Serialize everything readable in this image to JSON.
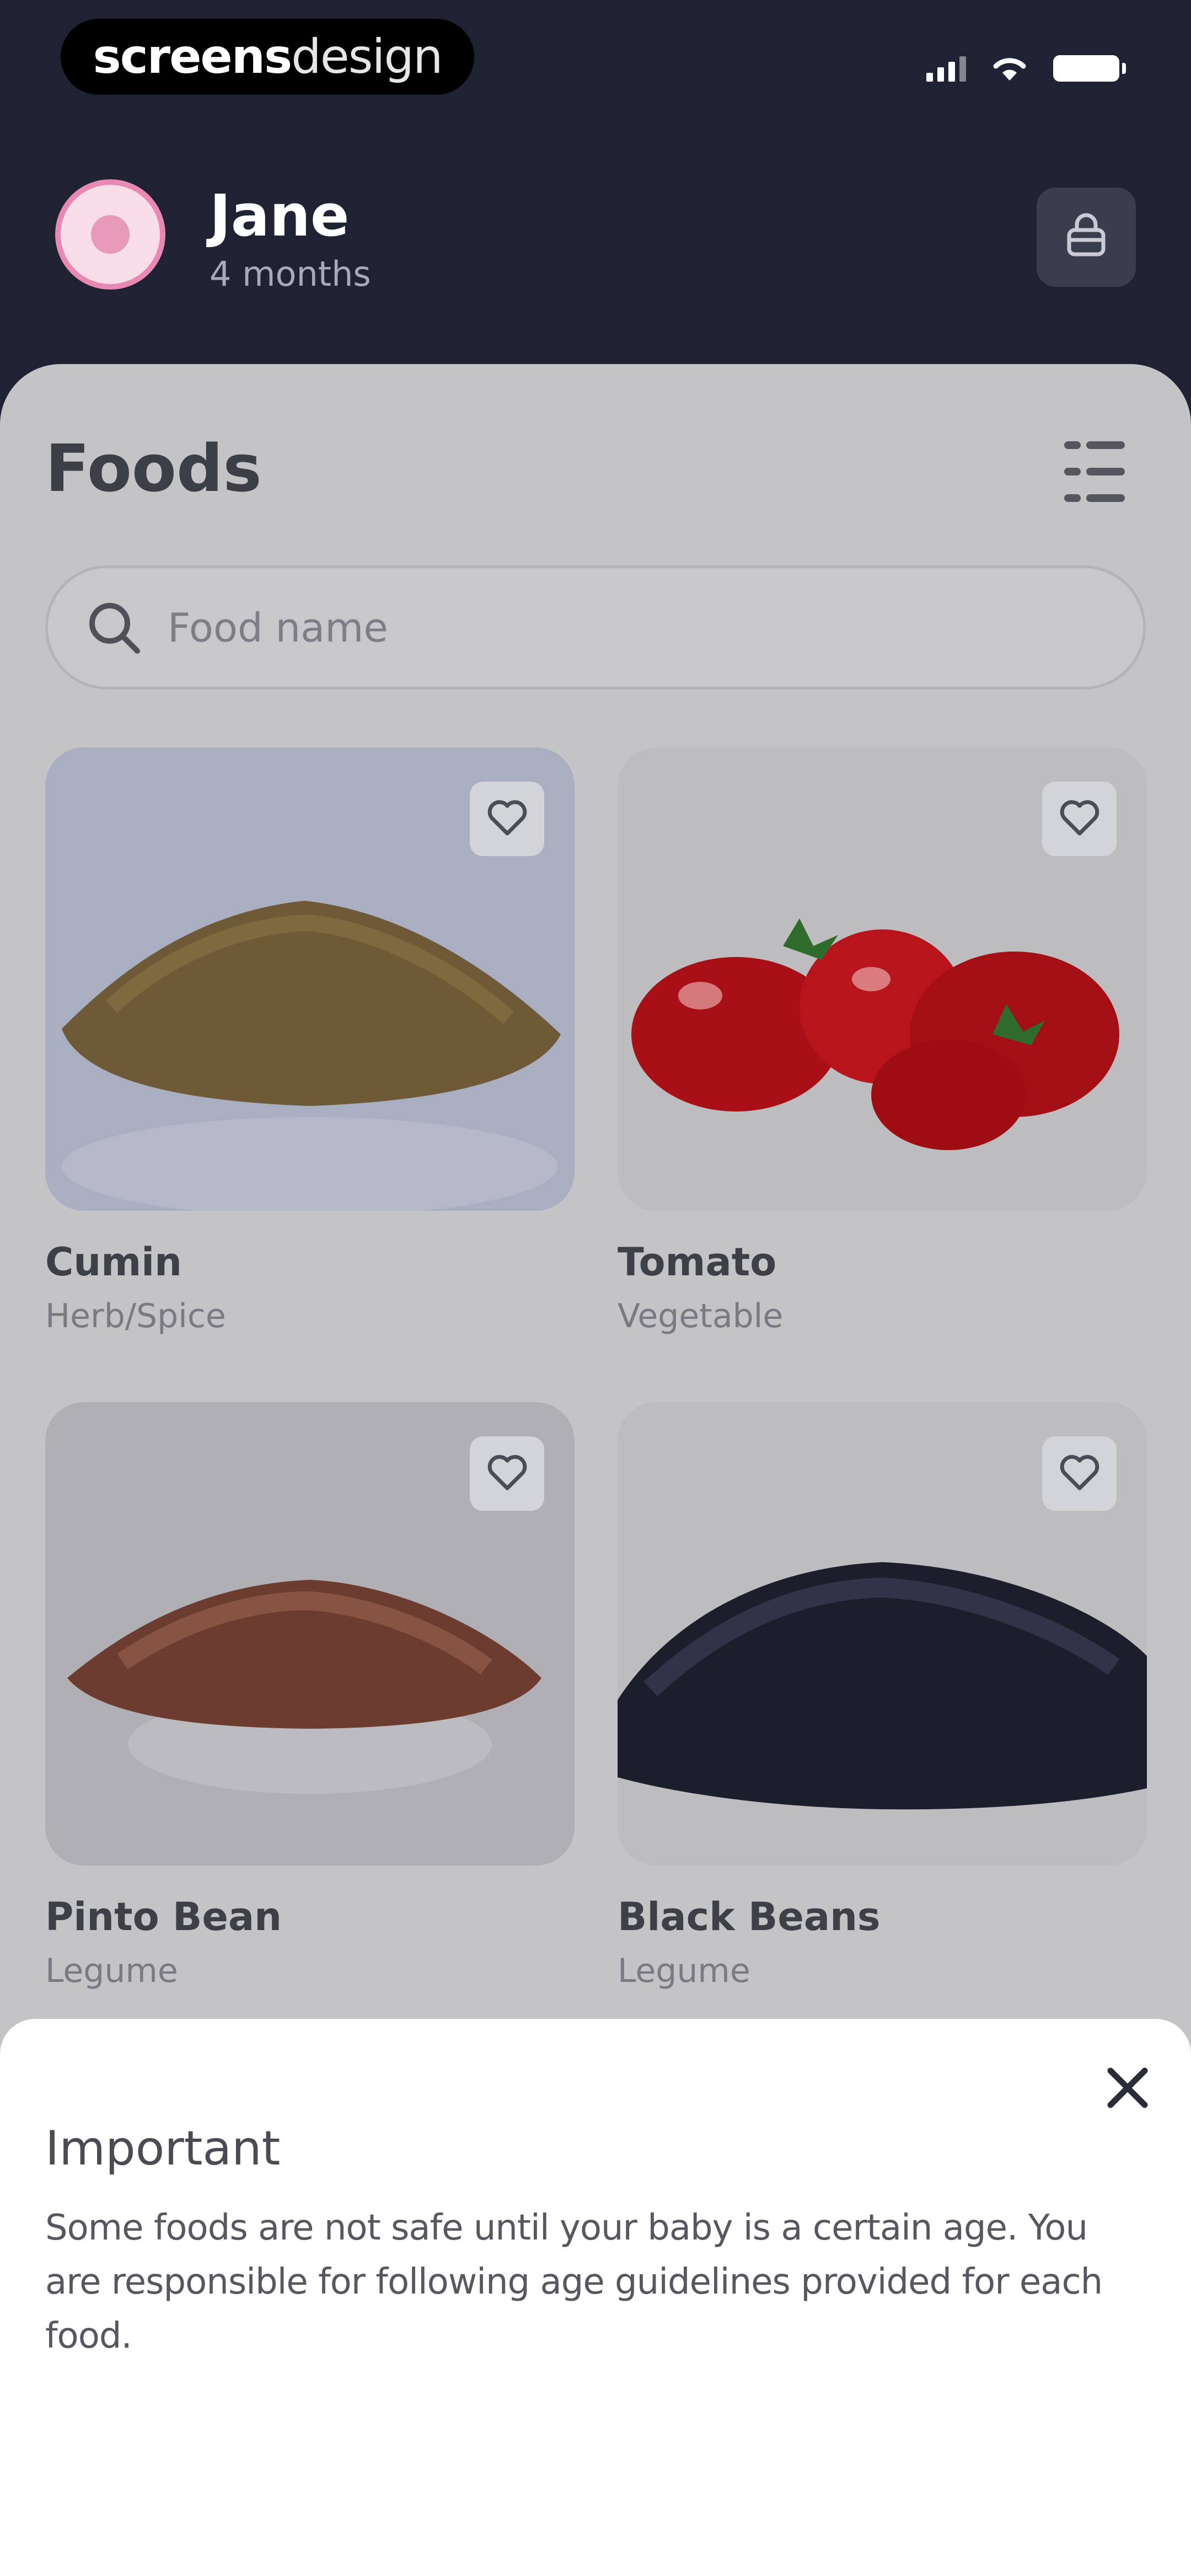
{
  "status_bar": {
    "brand_bold": "screens",
    "brand_light": "design"
  },
  "profile": {
    "name": "Jane",
    "age": "4 months"
  },
  "main": {
    "title": "Foods",
    "search": {
      "placeholder": "Food name",
      "value": ""
    }
  },
  "foods": [
    {
      "name": "Cumin",
      "category": "Herb/Spice"
    },
    {
      "name": "Tomato",
      "category": "Vegetable"
    },
    {
      "name": "Pinto Bean",
      "category": "Legume"
    },
    {
      "name": "Black Beans",
      "category": "Legume"
    }
  ],
  "notice": {
    "title": "Important",
    "body": "Some foods are not safe until your baby is a certain age. You are responsible for following age guidelines provided for each food."
  },
  "colors": {
    "header_bg": "#1f2232",
    "avatar_ring": "#e889b3",
    "dim_overlay": "#c4c4c7",
    "notice_bg": "#ffffff"
  }
}
